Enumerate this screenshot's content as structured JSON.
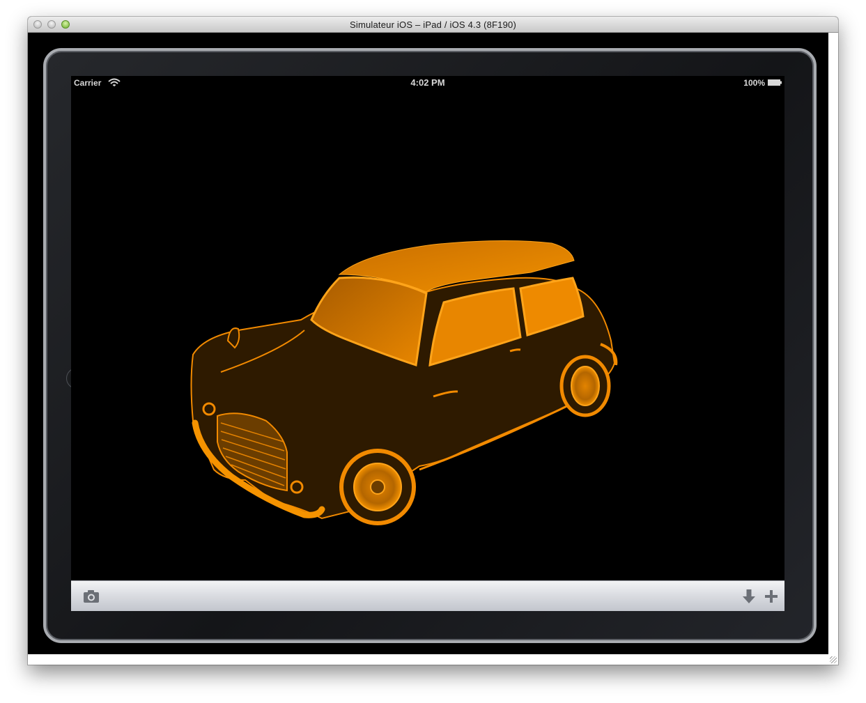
{
  "window": {
    "title": "Simulateur iOS – iPad / iOS 4.3 (8F190)"
  },
  "statusbar": {
    "carrier": "Carrier",
    "time": "4:02 PM",
    "battery": "100%"
  },
  "icons": {
    "wifi": "wifi-icon",
    "battery": "battery-icon",
    "camera": "camera-icon",
    "download": "arrow-down-icon",
    "add": "plus-icon",
    "home": "home-button-icon"
  },
  "colors": {
    "model_bright": "#f28a00",
    "model_dark": "#2e1a00",
    "background": "#000000",
    "toolbar_icon": "#6b6f76"
  }
}
